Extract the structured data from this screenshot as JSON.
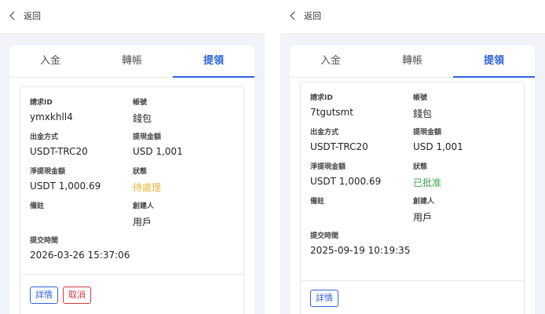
{
  "panels": [
    {
      "back_label": "返回",
      "tabs": [
        {
          "label": "入金"
        },
        {
          "label": "轉帳"
        },
        {
          "label": "提領"
        }
      ],
      "record": {
        "request_id_label": "請求ID",
        "request_id": "ymxkhll4",
        "wallet_label": "帳號",
        "wallet": "錢包",
        "method_label": "出金方式",
        "method": "USDT-TRC20",
        "amount_label": "提現金額",
        "amount": "USD 1,001",
        "net_label": "淨提現金額",
        "net": "USDT 1,000.69",
        "status_label": "狀態",
        "status": "待處理",
        "note_label": "備註",
        "note": "",
        "creator_label": "創建人",
        "creator": "用戶",
        "time_label": "提交時間",
        "time": "2026-03-26 15:37:06"
      },
      "buttons": {
        "detail": "詳情",
        "cancel": "取消"
      }
    },
    {
      "back_label": "返回",
      "tabs": [
        {
          "label": "入金"
        },
        {
          "label": "轉帳"
        },
        {
          "label": "提領"
        }
      ],
      "record": {
        "request_id_label": "請求ID",
        "request_id": "7tgutsmt",
        "wallet_label": "帳號",
        "wallet": "錢包",
        "method_label": "出金方式",
        "method": "USDT-TRC20",
        "amount_label": "提現金額",
        "amount": "USD 1,001",
        "net_label": "淨提現金額",
        "net": "USDT 1,000.69",
        "status_label": "狀態",
        "status": "已批准",
        "note_label": "備註",
        "note": "",
        "creator_label": "創建人",
        "creator": "用戶",
        "time_label": "提交時間",
        "time": "2025-09-19 10:19:35"
      },
      "buttons": {
        "detail": "詳情"
      }
    }
  ],
  "colors": {
    "accent": "#2f63d8",
    "pending": "#e7b43a",
    "approved": "#3aa74a",
    "danger": "#d33b3b"
  }
}
